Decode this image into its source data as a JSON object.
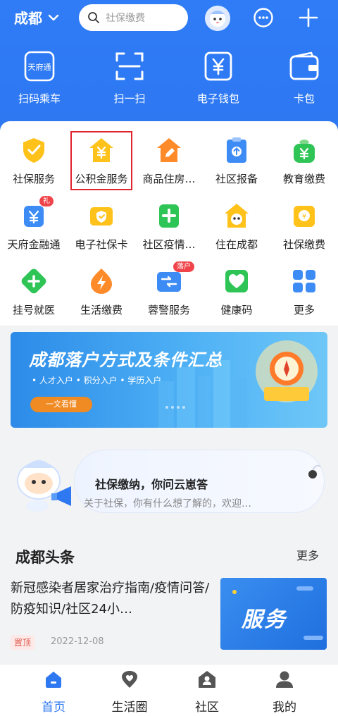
{
  "header": {
    "city": "成都",
    "search_placeholder": "社保缴费",
    "quick_actions": [
      {
        "label": "扫码乘车",
        "icon": "tianfu-card-icon"
      },
      {
        "label": "扫一扫",
        "icon": "scan-icon"
      },
      {
        "label": "电子钱包",
        "icon": "wallet-yen-icon"
      },
      {
        "label": "卡包",
        "icon": "card-wallet-icon"
      }
    ],
    "logo_text": "天府通"
  },
  "services": [
    {
      "label": "社保服务",
      "icon": "shield-check-icon"
    },
    {
      "label": "公积金服务",
      "icon": "house-yen-icon"
    },
    {
      "label": "商品住房…",
      "icon": "house-pen-icon"
    },
    {
      "label": "社区报备",
      "icon": "clipboard-up-icon"
    },
    {
      "label": "教育缴费",
      "icon": "bag-yen-icon"
    },
    {
      "label": "天府金融通",
      "icon": "money-bag-icon",
      "badge": "礼"
    },
    {
      "label": "电子社保卡",
      "icon": "shield-card-icon"
    },
    {
      "label": "社区疫情…",
      "icon": "medical-shield-icon"
    },
    {
      "label": "住在成都",
      "icon": "panda-house-icon"
    },
    {
      "label": "社保缴费",
      "icon": "wallet-coin-icon"
    },
    {
      "label": "挂号就医",
      "icon": "medical-cross-icon"
    },
    {
      "label": "生活缴费",
      "icon": "lightning-icon"
    },
    {
      "label": "蓉警服务",
      "icon": "police-card-icon",
      "badge": "落户"
    },
    {
      "label": "健康码",
      "icon": "heart-check-icon"
    },
    {
      "label": "更多",
      "icon": "grid-more-icon"
    }
  ],
  "banner": {
    "title": "成都落户方式及条件汇总",
    "subtitle": "• 人才入户  • 积分入户  • 学历入户",
    "button": "一文看懂"
  },
  "assistant": {
    "title": "社保缴纳，你问云崽答",
    "subtitle": "关于社保，你有什么想了解的，欢迎…"
  },
  "news": {
    "section_title": "成都头条",
    "more": "更多",
    "headline": "新冠感染者居家治疗指南/疫情问答/防疫知识/社区24小…",
    "tag": "置顶",
    "date": "2022-12-08",
    "image_text": "服务"
  },
  "bottom_nav": [
    {
      "label": "首页",
      "icon": "home-icon",
      "active": true
    },
    {
      "label": "生活圈",
      "icon": "heart-location-icon",
      "active": false
    },
    {
      "label": "社区",
      "icon": "community-icon",
      "active": false
    },
    {
      "label": "我的",
      "icon": "profile-icon",
      "active": false
    }
  ],
  "colors": {
    "brand_blue": "#2e78f2",
    "highlight_red": "#e0242d",
    "accent_orange": "#f08a22"
  }
}
